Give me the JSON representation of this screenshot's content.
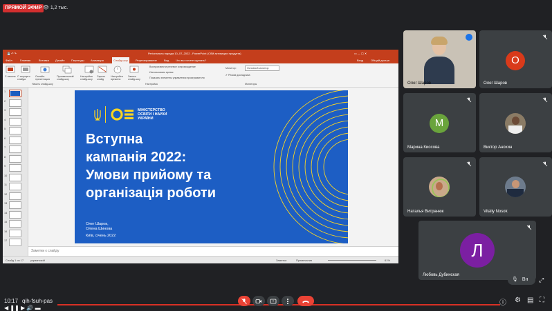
{
  "topbar": {
    "live_label": "ПРЯМОЙ ЭФИР",
    "viewers": "1,2 тыс."
  },
  "ppt": {
    "window_title": "Регіональна нарада 10_07_2022 - PowerPoint (Сбій активации продукта)",
    "user": "Вход",
    "share": "Общий доступ",
    "tabs": [
      "Файл",
      "Главная",
      "Вставка",
      "Дизайн",
      "Переходы",
      "Анимация",
      "Слайд-шоу",
      "Рецензирование",
      "Вид",
      "Что вы хотите сделать?"
    ],
    "ribbon": {
      "start": "С начала",
      "current": "С текущего слайда",
      "online": "Онлайн-презентация",
      "custom": "Произвольный слайд-шоу",
      "group1": "Начать слайд-шоу",
      "setup": "Настройка слайд-шоу",
      "hide": "Скрыть слайд",
      "rehearse": "Настройка времени",
      "record": "Запись слайд-шоу",
      "play_narrations": "Воспроизвести речевое сопровождение",
      "use_timings": "Использовать время",
      "show_media": "Показать элементы управления проигрывателя",
      "group2": "Настройка",
      "monitor_label": "Монитор:",
      "monitor_value": "Основной монитор",
      "presenter_view": "Режим докладчика",
      "group3": "Мониторы"
    },
    "thumb_numbers": [
      "1",
      "2",
      "3",
      "4",
      "5",
      "6",
      "7",
      "8",
      "9",
      "10",
      "11",
      "12",
      "13",
      "14",
      "15",
      "16",
      "17"
    ],
    "notes_placeholder": "Заметки к слайду",
    "status_left": "Слайд 1 из 17",
    "status_lang": "украинский",
    "status_notes": "Заметки",
    "status_comments": "Примечания",
    "status_zoom": "61%"
  },
  "slide": {
    "ministry": [
      "МІНІСТЕРСТВО",
      "ОСВІТИ І НАУКИ",
      "УКРАЇНИ"
    ],
    "heading": [
      "Вступна",
      "кампанія 2022:",
      "Умови прийому та",
      "організація роботи"
    ],
    "authors": [
      "Олег Шаров,",
      "Олена Шинова"
    ],
    "place": "Київ, січень 2022"
  },
  "participants": [
    {
      "name": "Олег Шаров",
      "type": "photo",
      "speaking": true
    },
    {
      "name": "Олег Шаров",
      "type": "letter",
      "letter": "О",
      "color": "#d93a1a"
    },
    {
      "name": "Марина Киосова",
      "type": "letter",
      "letter": "М",
      "color": "#6aa43c"
    },
    {
      "name": "Виктор Анохин",
      "type": "photo"
    },
    {
      "name": "Наталья Витранюк",
      "type": "photo"
    },
    {
      "name": "Vitaliy Nosok",
      "type": "photo"
    },
    {
      "name": "Любовь Дубинская",
      "type": "letter",
      "letter": "Л",
      "color": "#7b1fa2"
    }
  ],
  "bottom": {
    "time": "10:17",
    "meeting_code": "qih-fsuh-pas",
    "lang_short": "Вн"
  },
  "colors": {
    "live": "#d32f2f",
    "ppt_accent": "#c43e1c",
    "slide_blue": "#1d5ec4",
    "slide_yellow": "#f9d423",
    "hangup": "#ea4335"
  }
}
